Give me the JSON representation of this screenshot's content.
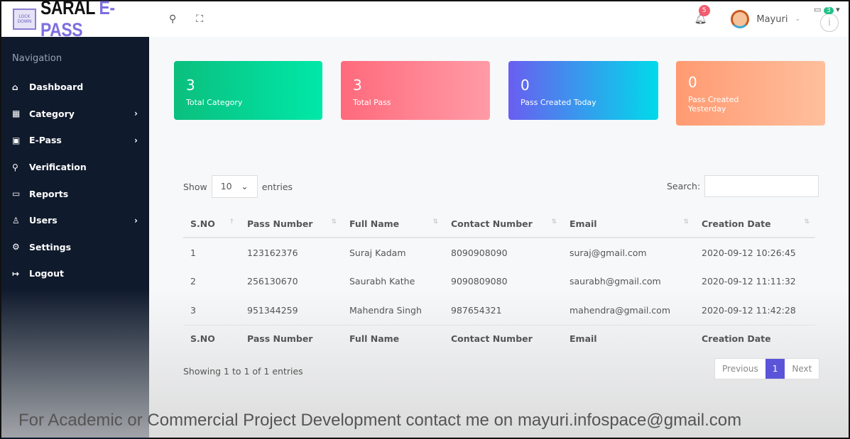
{
  "brand": {
    "logo_text": "LOCK DOWN",
    "name_a": "SARAL",
    "name_b": "E-PASS"
  },
  "topbar": {
    "notifications": "5",
    "user": "Mayuri",
    "messages": "3",
    "info": "i"
  },
  "sidebar": {
    "heading": "Navigation",
    "items": [
      {
        "label": "Dashboard",
        "icon": "⌂",
        "arrow": ""
      },
      {
        "label": "Category",
        "icon": "▦",
        "arrow": "›"
      },
      {
        "label": "E-Pass",
        "icon": "▣",
        "arrow": "›"
      },
      {
        "label": "Verification",
        "icon": "⚲",
        "arrow": ""
      },
      {
        "label": "Reports",
        "icon": "▭",
        "arrow": ""
      },
      {
        "label": "Users",
        "icon": "♙",
        "arrow": "›"
      },
      {
        "label": "Settings",
        "icon": "⚙",
        "arrow": ""
      },
      {
        "label": "Logout",
        "icon": "↦",
        "arrow": ""
      }
    ]
  },
  "cards": [
    {
      "value": "3",
      "label": "Total Category"
    },
    {
      "value": "3",
      "label": "Total Pass"
    },
    {
      "value": "0",
      "label": "Pass Created Today"
    },
    {
      "value": "0",
      "label": "Pass Created Yesterday"
    }
  ],
  "table": {
    "show": "Show",
    "entries_value": "10",
    "entries": "entries",
    "search": "Search:",
    "headers": [
      "S.NO",
      "Pass Number",
      "Full Name",
      "Contact Number",
      "Email",
      "Creation Date"
    ],
    "rows": [
      [
        "1",
        "123162376",
        "Suraj Kadam",
        "8090908090",
        "suraj@gmail.com",
        "2020-09-12 10:26:45"
      ],
      [
        "2",
        "256130670",
        "Saurabh Kathe",
        "9090809080",
        "saurabh@gmail.com",
        "2020-09-12 11:11:32"
      ],
      [
        "3",
        "951344259",
        "Mahendra Singh",
        "987654321",
        "mahendra@gmail.com",
        "2020-09-12 11:42:28"
      ]
    ],
    "info": "Showing 1 to 1 of 1 entries",
    "prev": "Previous",
    "page": "1",
    "next": "Next"
  },
  "watermark": "For Academic or Commercial Project Development  contact me on mayuri.infospace@gmail.com"
}
